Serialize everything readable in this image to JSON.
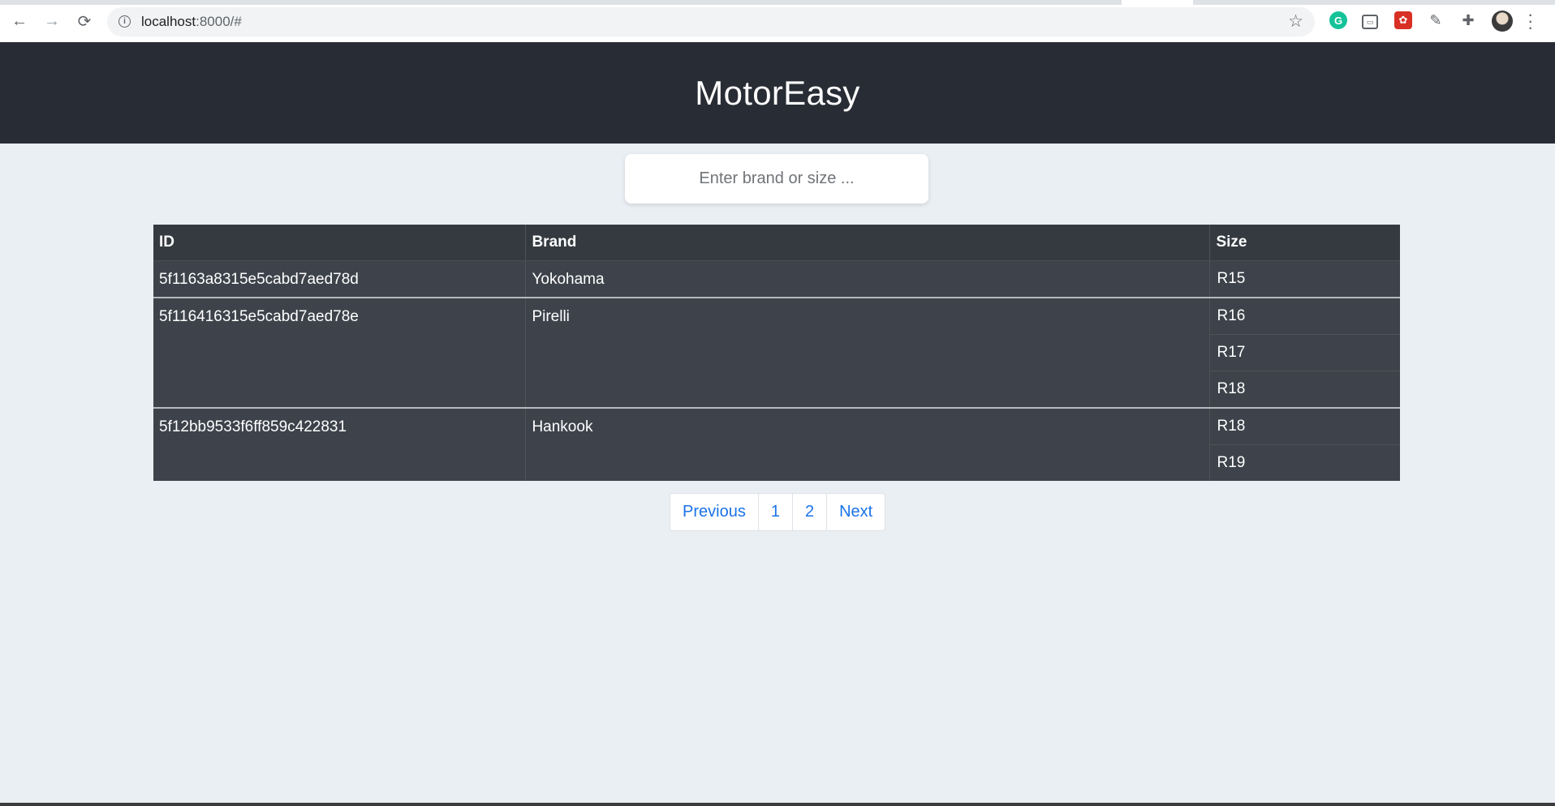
{
  "browser": {
    "url_host": "localhost",
    "url_rest": ":8000/#",
    "nav": {
      "back": "←",
      "forward": "→",
      "reload": "⟳"
    },
    "icons": [
      "back-icon",
      "forward-icon",
      "reload-icon",
      "info-icon",
      "star-icon",
      "grammarly-icon",
      "extension-box-icon",
      "extension-red-icon",
      "eyedropper-icon",
      "puzzle-icon",
      "avatar",
      "kebab-menu-icon"
    ]
  },
  "app": {
    "title": "MotorEasy"
  },
  "search": {
    "placeholder": "Enter brand or size ..."
  },
  "table": {
    "headers": {
      "id": "ID",
      "brand": "Brand",
      "size": "Size"
    },
    "rows": [
      {
        "id": "5f1163a8315e5cabd7aed78d",
        "brand": "Yokohama",
        "sizes": [
          "R15"
        ]
      },
      {
        "id": "5f116416315e5cabd7aed78e",
        "brand": "Pirelli",
        "sizes": [
          "R16",
          "R17",
          "R18"
        ]
      },
      {
        "id": "5f12bb9533f6ff859c422831",
        "brand": "Hankook",
        "sizes": [
          "R18",
          "R19"
        ]
      }
    ]
  },
  "pagination": {
    "previous": "Previous",
    "pages": [
      "1",
      "2"
    ],
    "next": "Next"
  },
  "colors": {
    "header_bg": "#282c34",
    "table_bg": "#3e434b",
    "page_bg": "#eaeff4",
    "link": "#1a73e8"
  }
}
